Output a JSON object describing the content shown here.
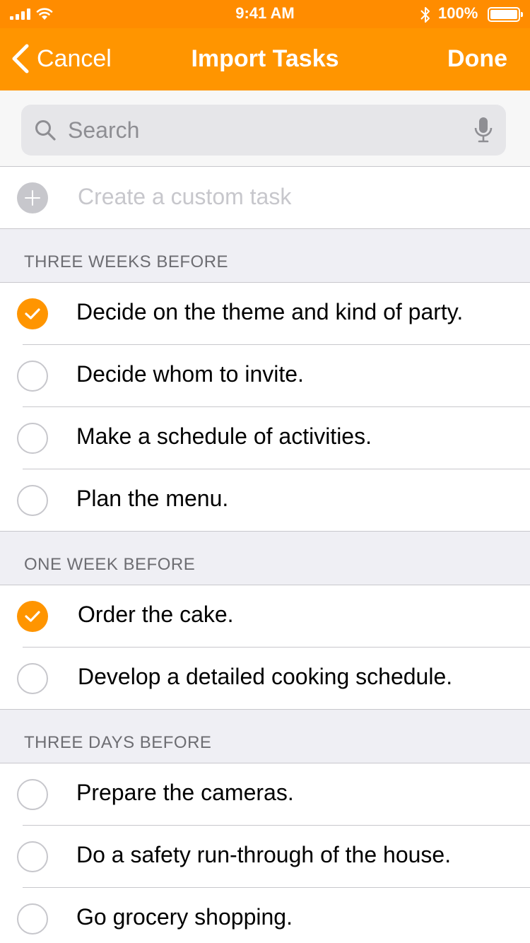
{
  "status_bar": {
    "time": "9:41 AM",
    "battery_text": "100%",
    "battery_level": 1.0,
    "icons": [
      "signal-icon",
      "wifi-icon",
      "bluetooth-icon",
      "battery-icon"
    ]
  },
  "nav": {
    "back_label": "Cancel",
    "title": "Import Tasks",
    "done_label": "Done"
  },
  "search": {
    "placeholder": "Search",
    "value": ""
  },
  "custom_task": {
    "placeholder": "Create a custom task"
  },
  "sections": [
    {
      "header": "THREE WEEKS BEFORE",
      "tasks": [
        {
          "label": "Decide on the theme and kind of party.",
          "checked": true
        },
        {
          "label": "Decide whom to invite.",
          "checked": false
        },
        {
          "label": "Make a schedule of activities.",
          "checked": false
        },
        {
          "label": "Plan the menu.",
          "checked": false
        }
      ]
    },
    {
      "header": "ONE WEEK BEFORE",
      "tasks": [
        {
          "label": "Order the cake.",
          "checked": true
        },
        {
          "label": "Develop a detailed cooking schedule.",
          "checked": false
        }
      ]
    },
    {
      "header": "THREE DAYS BEFORE",
      "tasks": [
        {
          "label": "Prepare the cameras.",
          "checked": false
        },
        {
          "label": "Do a safety run-through of the house.",
          "checked": false
        },
        {
          "label": "Go grocery shopping.",
          "checked": false
        }
      ]
    }
  ],
  "colors": {
    "accent": "#ff9500",
    "status_bar": "#ff8c00",
    "section_bg": "#efeff4",
    "separator": "#c8c7cc"
  }
}
